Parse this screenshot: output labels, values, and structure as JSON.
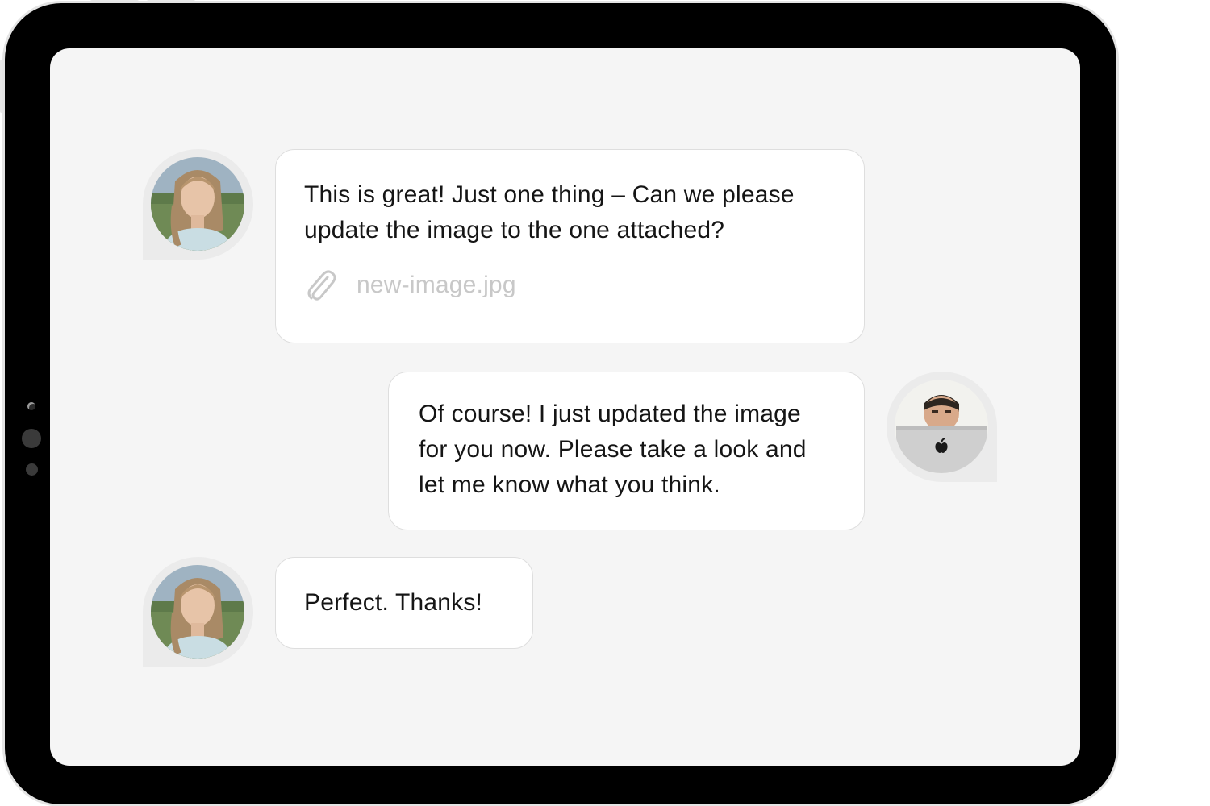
{
  "colors": {
    "device": "#000000",
    "screen": "#f5f5f5",
    "bubble": "#ffffff",
    "bubble_border": "#dedede",
    "text": "#151515",
    "attachment_text": "#c8c8c8",
    "avatar_ring": "#ebebeb"
  },
  "chat": {
    "messages": [
      {
        "sender": "customer",
        "lines": [
          "This is great! Just one thing – Can we please",
          "update the image to the one attached?"
        ],
        "attachment": {
          "icon": "paperclip-icon",
          "filename": "new-image.jpg"
        }
      },
      {
        "sender": "agent",
        "lines": [
          "Of course! I just updated the image",
          "for you now. Please take a look and",
          "let me know what you think."
        ]
      },
      {
        "sender": "customer",
        "lines": [
          "Perfect. Thanks!"
        ]
      }
    ]
  }
}
